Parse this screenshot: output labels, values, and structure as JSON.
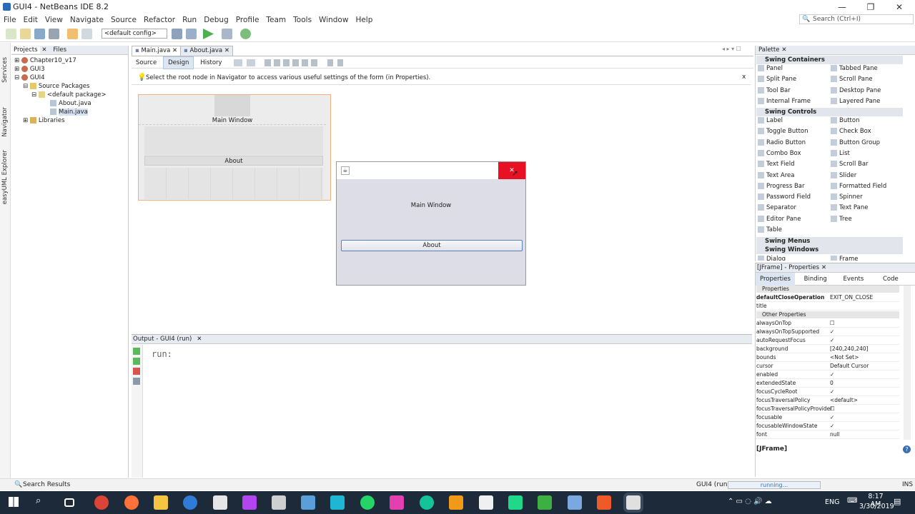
{
  "window": {
    "title": "GUI4 - NetBeans IDE 8.2"
  },
  "menu": [
    "File",
    "Edit",
    "View",
    "Navigate",
    "Source",
    "Refactor",
    "Run",
    "Debug",
    "Profile",
    "Team",
    "Tools",
    "Window",
    "Help"
  ],
  "search": {
    "placeholder": "Search (Ctrl+I)"
  },
  "toolbar": {
    "config": "<default config>"
  },
  "side_strip": {
    "services": "Services",
    "navigator": "Navigator",
    "easyuml": "easyUML Explorer"
  },
  "projects": {
    "tab_projects": "Projects",
    "tab_files": "Files",
    "items": [
      "Chapter10_v17",
      "GUI3",
      "GUI4",
      "Source Packages",
      "<default package>",
      "About.java",
      "Main.java",
      "Libraries"
    ]
  },
  "editor": {
    "tabs": [
      "Main.java",
      "About.java"
    ],
    "subtabs": [
      "Source",
      "Design",
      "History"
    ],
    "hint": "Select the root node in Navigator to access various useful settings of the form (in Properties).",
    "close_hint": "x",
    "form": {
      "label": "Main Window",
      "button": "About"
    }
  },
  "running_window": {
    "label": "Main Window",
    "button": "About"
  },
  "output": {
    "title": "Output - GUI4 (run)",
    "text": "run:"
  },
  "palette": {
    "title": "Palette",
    "sections": {
      "containers": "Swing Containers",
      "controls": "Swing Controls",
      "menus": "Swing Menus",
      "windows": "Swing Windows"
    },
    "containers": [
      "Panel",
      "Tabbed Pane",
      "Split Pane",
      "Scroll Pane",
      "Tool Bar",
      "Desktop Pane",
      "Internal Frame",
      "Layered Pane"
    ],
    "controls": [
      "Label",
      "Button",
      "Toggle Button",
      "Check Box",
      "Radio Button",
      "Button Group",
      "Combo Box",
      "List",
      "Text Field",
      "Scroll Bar",
      "Text Area",
      "Slider",
      "Progress Bar",
      "Formatted Field",
      "Password Field",
      "Spinner",
      "Separator",
      "Text Pane",
      "Editor Pane",
      "Tree",
      "Table"
    ],
    "windows": [
      "Dialog",
      "Frame"
    ]
  },
  "properties": {
    "title": "[JFrame] - Properties",
    "tabs": [
      "Properties",
      "Binding",
      "Events",
      "Code"
    ],
    "group1": "Properties",
    "group2": "Other Properties",
    "rows": [
      {
        "name": "defaultCloseOperation",
        "value": "EXIT_ON_CLOSE"
      },
      {
        "name": "title",
        "value": ""
      },
      {
        "name": "alwaysOnTop",
        "value": "☐"
      },
      {
        "name": "alwaysOnTopSupported",
        "value": "✓"
      },
      {
        "name": "autoRequestFocus",
        "value": "✓"
      },
      {
        "name": "background",
        "value": "[240,240,240]"
      },
      {
        "name": "bounds",
        "value": "<Not Set>"
      },
      {
        "name": "cursor",
        "value": "Default Cursor"
      },
      {
        "name": "enabled",
        "value": "✓"
      },
      {
        "name": "extendedState",
        "value": "0"
      },
      {
        "name": "focusCycleRoot",
        "value": "✓"
      },
      {
        "name": "focusTraversalPolicy",
        "value": "<default>"
      },
      {
        "name": "focusTraversalPolicyProvider",
        "value": "☐"
      },
      {
        "name": "focusable",
        "value": "✓"
      },
      {
        "name": "focusableWindowState",
        "value": "✓"
      },
      {
        "name": "font",
        "value": "null"
      }
    ],
    "footer": "[JFrame]"
  },
  "status": {
    "search": "Search Results",
    "run": "GUI4 (run)",
    "running": "running...",
    "ins": "INS"
  },
  "taskbar": {
    "time": "8:17 AM",
    "date": "3/30/2019",
    "lang": "ENG"
  },
  "colors": {
    "accent": "#e81123",
    "taskbar": "#1c2a3a"
  }
}
